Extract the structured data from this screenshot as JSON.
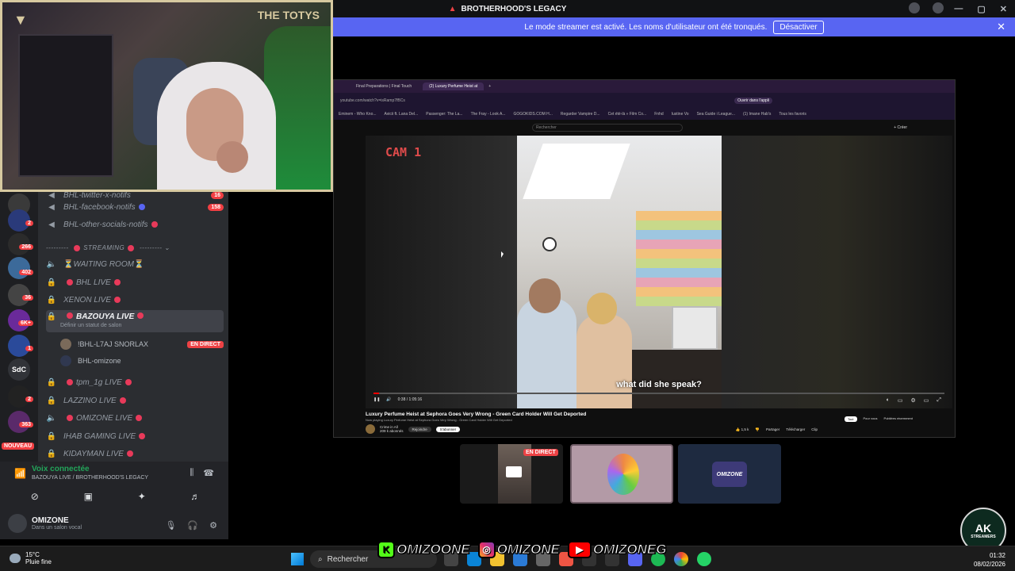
{
  "window": {
    "title": "BROTHERHOOD'S LEGACY"
  },
  "banner": {
    "text": "Le mode streamer est activé. Les noms d'utilisateur ont été tronqués.",
    "button": "Désactiver"
  },
  "webcam": {
    "brand_right": "THE TOTYS"
  },
  "servers": {
    "badges": [
      "2",
      "266",
      "402",
      "36",
      "6K+",
      "1",
      "2",
      "363"
    ],
    "sdc_label": "SdC",
    "new_label": "NOUVEAU"
  },
  "channels": {
    "items": [
      {
        "name": "BHL-twitter-x-notifs",
        "pill": "16"
      },
      {
        "name": "BHL-facebook-notifs",
        "pill": "158"
      },
      {
        "name": "BHL-other-socials-notifs",
        "pill": ""
      }
    ],
    "category": "STREAMING",
    "voice": [
      {
        "name": "WAITING ROOM"
      },
      {
        "name": "BHL LIVE"
      },
      {
        "name": "XENON LIVE"
      },
      {
        "name": "BAZOUYA LIVE",
        "status": "Définir un statut de salon"
      },
      {
        "name": "tpm_1g LIVE"
      },
      {
        "name": "LAZZINO LIVE"
      },
      {
        "name": "OMIZONE LIVE"
      },
      {
        "name": "IHAB GAMING LIVE"
      },
      {
        "name": "KIDAYMAN LIVE"
      }
    ],
    "users": [
      {
        "name": "!BHL-L7AJ SNORLAX",
        "live": "EN DIRECT"
      },
      {
        "name": "BHL-omizone",
        "live": ""
      }
    ]
  },
  "voice_panel": {
    "title": "Voix connectée",
    "subtitle": "BAZOUYA LIVE / BROTHERHOOD'S LEGACY",
    "user": "OMIZONE",
    "user_status": "Dans un salon vocal"
  },
  "browser": {
    "tabs": [
      "Final Preparations | Final Touch",
      "(2) Luxury Perfume Heist at"
    ],
    "url": "youtube.com/watch?v=isRamp7fBCs",
    "open_app": "Ouvrir dans l'appli",
    "bookmarks": [
      "Eminem - Who Kno...",
      "Avicii ft. Lana Del...",
      "Passenger: The La...",
      "The Fray - Look A...",
      "GOGOKIDS.COM H...",
      "Regarder Vampire D...",
      "Cet été-là » Film Co...",
      "Fnhd",
      "Iustine Vo",
      "Sea Guide i League...",
      "(1) Imane Hab's",
      "Tous les favoris"
    ],
    "search_placeholder": "Rechercher",
    "create": "+ Créer"
  },
  "video": {
    "cam_label": "CAM 1",
    "subtitle": "what did she speak?",
    "time": "0:38 / 1:05:16",
    "progress": 0.01,
    "title": "Luxury Perfume Heist at Sephora Goes Very Wrong - Green Card Holder Will Get Deported",
    "now_playing": "Now playing Luxury Perfume Heist at Sephora Goes Very Wrong - Green Card Holder Will Get Deported",
    "channel": "Crime in All",
    "subscribers": "209 k abonnés",
    "join": "Rejoindre",
    "subscribe": "S'abonner",
    "likes": "1,5 k",
    "share": "Partager",
    "download": "Télécharger",
    "clip": "Clip",
    "filters": [
      "Tout",
      "Pour vous",
      "Publiées récemment"
    ]
  },
  "tiles": {
    "live": "EN DIRECT",
    "brand": "OMIZONE"
  },
  "watermark": {
    "text": "AK",
    "sub": "STREAMERS"
  },
  "socials": [
    {
      "icon": "kick-icon",
      "handle": "OMIZOONE"
    },
    {
      "icon": "instagram-icon",
      "handle": "OMIZONE"
    },
    {
      "icon": "youtube-icon",
      "handle": "OMIZONEG"
    }
  ],
  "taskbar": {
    "temp": "15°C",
    "weather": "Pluie fine",
    "search": "Rechercher",
    "time": "01:32",
    "date": "08/02/2026"
  }
}
